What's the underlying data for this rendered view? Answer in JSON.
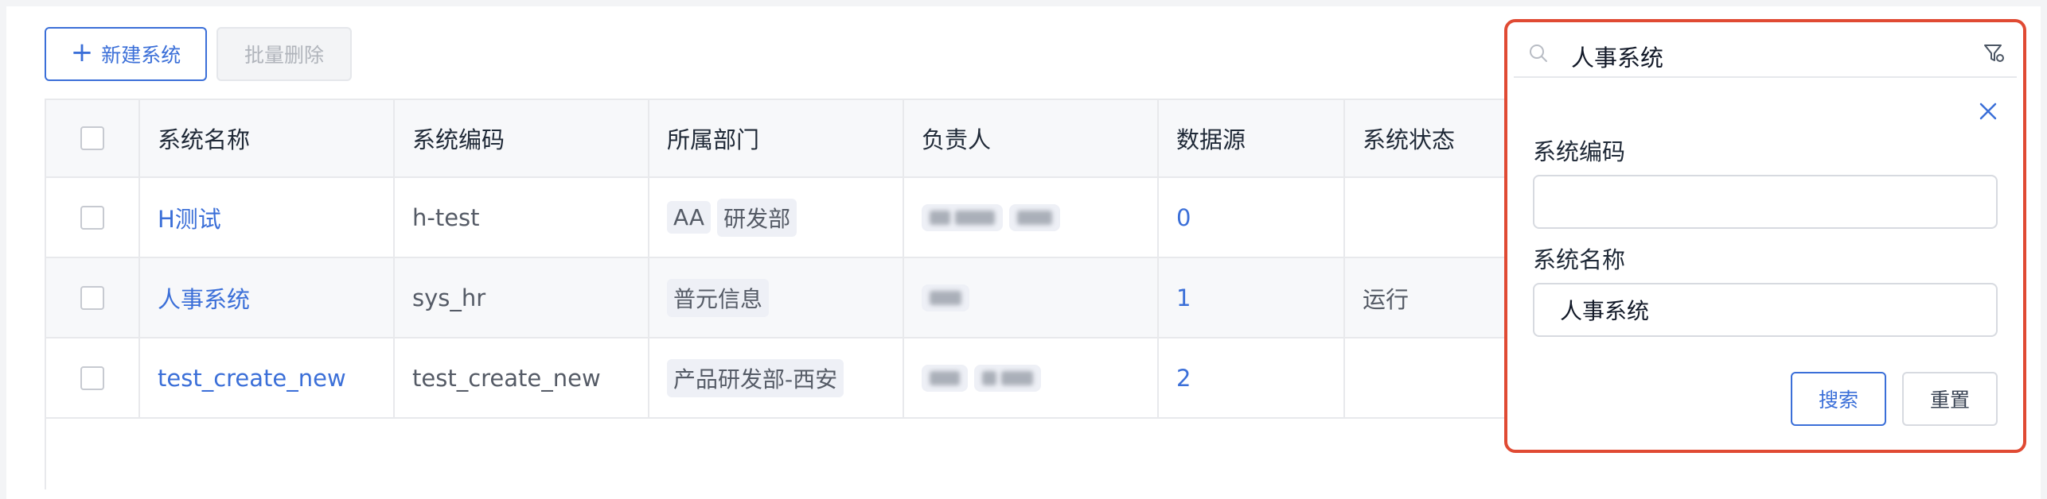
{
  "toolbar": {
    "new_label": "新建系统",
    "batch_delete_label": "批量删除"
  },
  "table": {
    "columns": [
      "系统名称",
      "系统编码",
      "所属部门",
      "负责人",
      "数据源",
      "系统状态"
    ],
    "rows": [
      {
        "name": "H测试",
        "code": "h-test",
        "departments": [
          "AA",
          "研发部"
        ],
        "datasource": "0",
        "status": ""
      },
      {
        "name": "人事系统",
        "code": "sys_hr",
        "departments": [
          "普元信息"
        ],
        "datasource": "1",
        "status": "运行"
      },
      {
        "name": "test_create_new",
        "code": "test_create_new",
        "departments": [
          "产品研发部-西安"
        ],
        "datasource": "2",
        "status": ""
      }
    ]
  },
  "filter": {
    "search_value": "人事系统",
    "code_label": "系统编码",
    "code_value": "",
    "name_label": "系统名称",
    "name_value": "人事系统",
    "search_button": "搜索",
    "reset_button": "重置"
  },
  "colors": {
    "accent": "#3b6fd8",
    "highlight_border": "#e04a33"
  },
  "icons": [
    "plus-icon",
    "search-icon",
    "filter-icon",
    "close-icon"
  ]
}
